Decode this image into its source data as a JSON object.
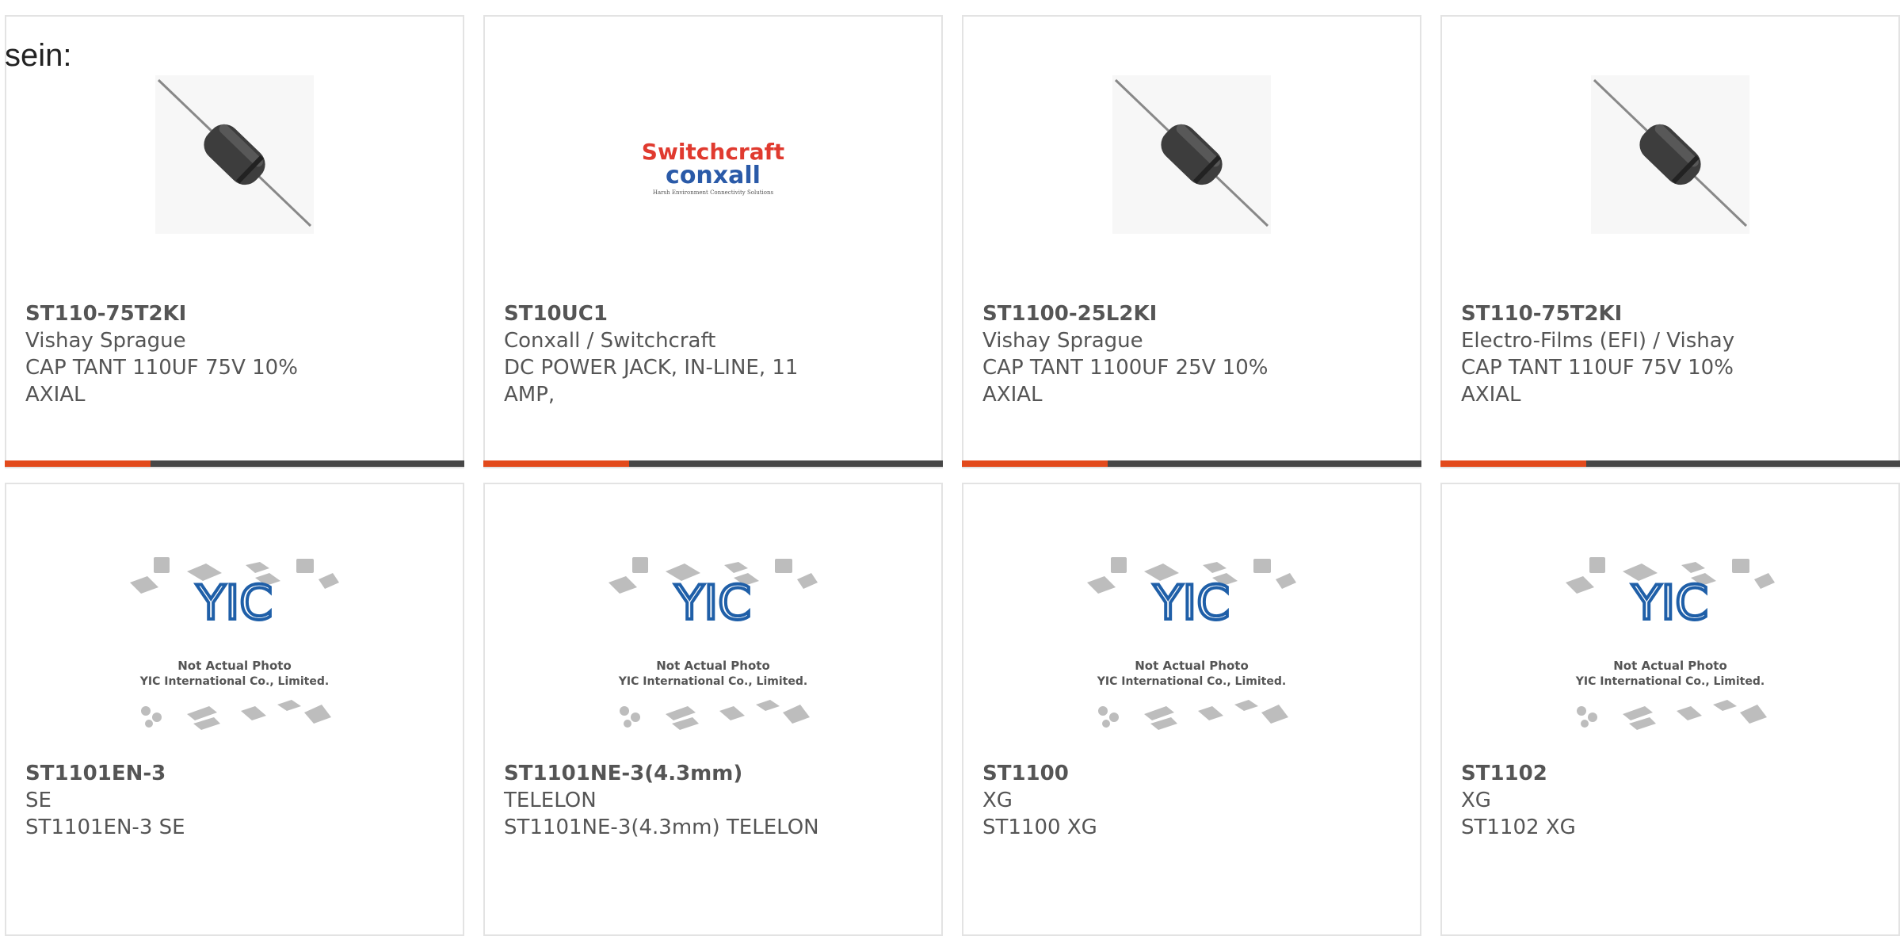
{
  "intro": "sein:",
  "products": [
    {
      "part": "ST110-75T2KI",
      "maker": "Vishay Sprague",
      "desc": "CAP TANT 110UF 75V 10% AXIAL",
      "image": "capacitor-photo"
    },
    {
      "part": "ST10UC1",
      "maker": "Conxall / Switchcraft",
      "desc": "DC POWER JACK, IN-LINE, 11 AMP,",
      "image": "switchcraft-logo"
    },
    {
      "part": "ST1100-25L2KI",
      "maker": "Vishay Sprague",
      "desc": "CAP TANT 1100UF 25V 10% AXIAL",
      "image": "capacitor-photo"
    },
    {
      "part": "ST110-75T2KI",
      "maker": "Electro-Films (EFI) / Vishay",
      "desc": "CAP TANT 110UF 75V 10% AXIAL",
      "image": "capacitor-photo"
    },
    {
      "part": "ST1101EN-3",
      "maker": "SE",
      "desc": "ST1101EN-3 SE",
      "image": "not-actual-photo"
    },
    {
      "part": "ST1101NE-3(4.3mm)",
      "maker": "TELELON",
      "desc": "ST1101NE-3(4.3mm) TELELON",
      "image": "not-actual-photo"
    },
    {
      "part": "ST1100",
      "maker": "XG",
      "desc": "ST1100 XG",
      "image": "not-actual-photo"
    },
    {
      "part": "ST1102",
      "maker": "XG",
      "desc": "ST1102 XG",
      "image": "not-actual-photo"
    }
  ],
  "logo": {
    "brand_top": "Switchcraft",
    "brand_bottom": "conxall",
    "tagline": "Harsh Environment Connectivity Solutions"
  },
  "placeholder": {
    "logo": "YIC",
    "line1": "Not Actual Photo",
    "line2": "YIC International Co., Limited."
  },
  "colors": {
    "accent": "#e24a1c",
    "bar": "#474747",
    "yic_blue": "#1f5fa8",
    "logo_red": "#e03a2f",
    "logo_blue": "#2a5aa8"
  }
}
